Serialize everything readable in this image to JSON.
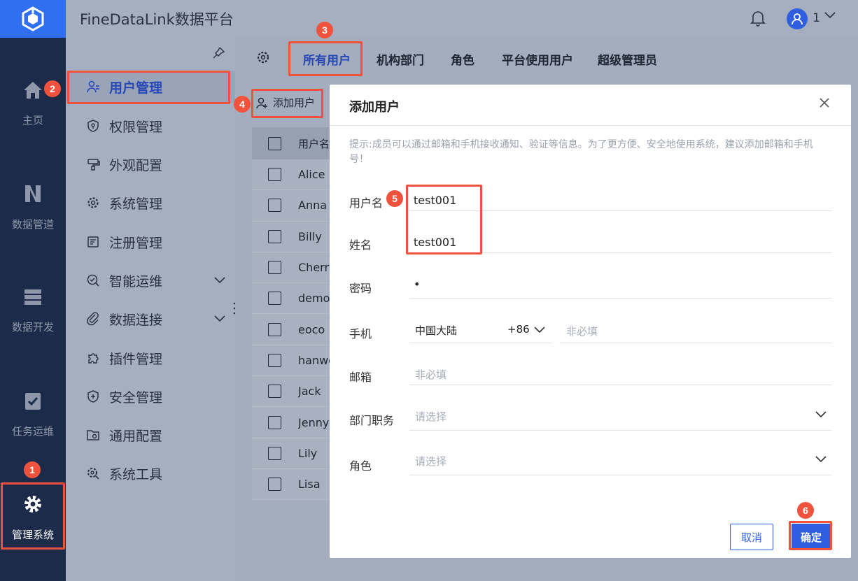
{
  "app": {
    "title": "FineDataLink数据平台",
    "user": "1"
  },
  "rail": [
    {
      "label": "主页",
      "icon": "home-icon"
    },
    {
      "label": "数据管道",
      "icon": "pipeline-icon"
    },
    {
      "label": "数据开发",
      "icon": "dev-icon"
    },
    {
      "label": "任务运维",
      "icon": "task-icon"
    },
    {
      "label": "管理系统",
      "icon": "gear-icon"
    }
  ],
  "menu": [
    {
      "label": "用户管理",
      "icon": "user-manage-icon"
    },
    {
      "label": "权限管理",
      "icon": "permission-icon"
    },
    {
      "label": "外观配置",
      "icon": "appearance-icon"
    },
    {
      "label": "系统管理",
      "icon": "system-icon"
    },
    {
      "label": "注册管理",
      "icon": "register-icon"
    },
    {
      "label": "智能运维",
      "icon": "ops-icon"
    },
    {
      "label": "数据连接",
      "icon": "connection-icon"
    },
    {
      "label": "插件管理",
      "icon": "plugin-icon"
    },
    {
      "label": "安全管理",
      "icon": "security-icon"
    },
    {
      "label": "通用配置",
      "icon": "general-config-icon"
    },
    {
      "label": "系统工具",
      "icon": "tools-icon"
    }
  ],
  "tabs": [
    "所有用户",
    "机构部门",
    "角色",
    "平台使用用户",
    "超级管理员"
  ],
  "toolbar": {
    "add_user": "添加用户"
  },
  "table": {
    "header": "用户名",
    "rows": [
      "Alice",
      "Anna",
      "Billy",
      "Cherry",
      "demo",
      "eoco",
      "hanwe",
      "Jack",
      "Jenny",
      "Lily",
      "Lisa"
    ]
  },
  "dialog": {
    "title": "添加用户",
    "hint": "提示:成员可以通过邮箱和手机接收通知、验证等信息。为了更方便、安全地使用系统，建议添加邮箱和手机号！",
    "fields": {
      "username": {
        "label": "用户名",
        "value": "test001"
      },
      "name": {
        "label": "姓名",
        "value": "test001"
      },
      "password": {
        "label": "密码",
        "value": "•"
      },
      "phone": {
        "label": "手机",
        "region": "中国大陆",
        "code": "+86",
        "placeholder": "非必填"
      },
      "email": {
        "label": "邮箱",
        "placeholder": "非必填"
      },
      "dept": {
        "label": "部门职务",
        "placeholder": "请选择"
      },
      "role": {
        "label": "角色",
        "placeholder": "请选择"
      }
    },
    "cancel": "取消",
    "ok": "确定"
  },
  "steps": [
    "1",
    "2",
    "3",
    "4",
    "5",
    "6"
  ],
  "colors": {
    "accent": "#2f5ee0",
    "annotation": "#f0533d",
    "rail": "#1c2b4a"
  }
}
